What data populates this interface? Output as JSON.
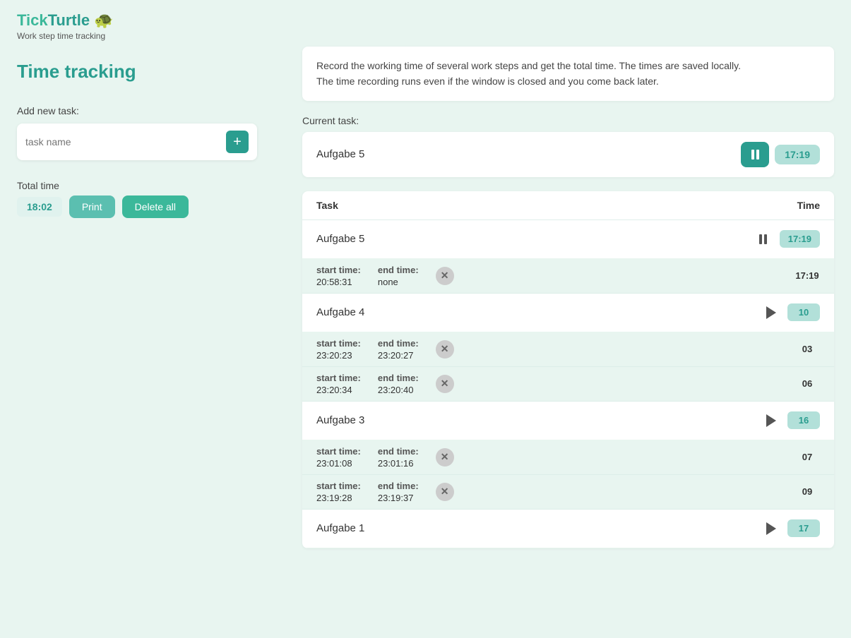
{
  "app": {
    "logo_tick": "Tick",
    "logo_turtle": "Turtle",
    "logo_icon": "🐢",
    "subtitle": "Work step time tracking"
  },
  "page": {
    "title": "Time tracking",
    "description_line1": "Record the working time of several work steps and get the total time. The times are saved locally.",
    "description_line2": "The time recording runs even if the window is closed and you come back later."
  },
  "left": {
    "add_task_label": "Add new task:",
    "task_name_placeholder": "task name",
    "add_btn_label": "+",
    "total_time_label": "Total time",
    "total_time_value": "18:02",
    "print_btn": "Print",
    "delete_all_btn": "Delete all"
  },
  "right": {
    "current_task_label": "Current task:",
    "current_task_name": "Aufgabe 5",
    "current_task_time": "17:19",
    "table_header_task": "Task",
    "table_header_time": "Time",
    "tasks": [
      {
        "id": "aufgabe5",
        "name": "Aufgabe 5",
        "time": "17:19",
        "is_active": true,
        "entries": [
          {
            "start_label": "start time:",
            "start_value": "20:58:31",
            "end_label": "end time:",
            "end_value": "none",
            "duration": "17:19"
          }
        ]
      },
      {
        "id": "aufgabe4",
        "name": "Aufgabe 4",
        "time": "10",
        "is_active": false,
        "entries": [
          {
            "start_label": "start time:",
            "start_value": "23:20:23",
            "end_label": "end time:",
            "end_value": "23:20:27",
            "duration": "03"
          },
          {
            "start_label": "start time:",
            "start_value": "23:20:34",
            "end_label": "end time:",
            "end_value": "23:20:40",
            "duration": "06"
          }
        ]
      },
      {
        "id": "aufgabe3",
        "name": "Aufgabe 3",
        "time": "16",
        "is_active": false,
        "entries": [
          {
            "start_label": "start time:",
            "start_value": "23:01:08",
            "end_label": "end time:",
            "end_value": "23:01:16",
            "duration": "07"
          },
          {
            "start_label": "start time:",
            "start_value": "23:19:28",
            "end_label": "end time:",
            "end_value": "23:19:37",
            "duration": "09"
          }
        ]
      },
      {
        "id": "aufgabe1",
        "name": "Aufgabe 1",
        "time": "17",
        "is_active": false,
        "entries": []
      }
    ]
  }
}
